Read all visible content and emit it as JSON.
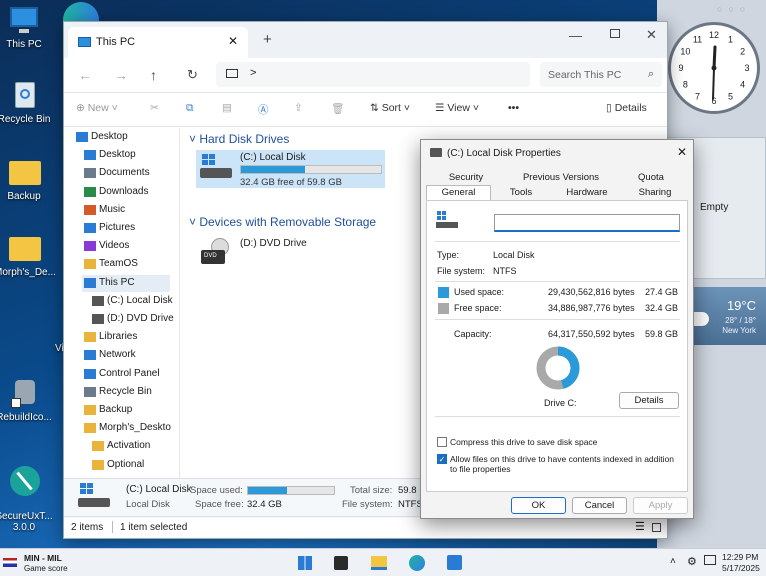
{
  "desktop": {
    "icons": [
      {
        "label": "This PC"
      },
      {
        "label": "Recycle Bin"
      },
      {
        "label": "Backup"
      },
      {
        "label": "Morph's_De..."
      },
      {
        "label": "RebuildIco..."
      },
      {
        "label": "SecureUxT...\n3.0.0"
      }
    ],
    "fragment_label": "Vi"
  },
  "widgets": {
    "clock_numbers": [
      "12",
      "1",
      "2",
      "3",
      "4",
      "5",
      "6",
      "7",
      "8",
      "9",
      "10",
      "11"
    ],
    "recycle_label": "Empty",
    "weather": {
      "temp": "19°C",
      "range": "28° / 18°",
      "city": "New York"
    }
  },
  "explorer": {
    "tab_title": "This PC",
    "new_tab_symbol": "+",
    "search_placeholder": "Search This PC",
    "address_chevron": ">",
    "commands": {
      "new": "New",
      "sort": "Sort",
      "view": "View",
      "more": "•••",
      "details": "Details"
    },
    "nav_items": [
      {
        "label": "Desktop",
        "color": "#2a7bd4"
      },
      {
        "label": "Desktop",
        "color": "#2a7bd4"
      },
      {
        "label": "Documents",
        "color": "#6b7a8c"
      },
      {
        "label": "Downloads",
        "color": "#2a8a4a"
      },
      {
        "label": "Music",
        "color": "#d45a2a"
      },
      {
        "label": "Pictures",
        "color": "#2a7bd4"
      },
      {
        "label": "Videos",
        "color": "#8a3ad4"
      },
      {
        "label": "TeamOS",
        "color": "#e8b43c"
      },
      {
        "label": "This PC",
        "color": "#2a7bd4"
      },
      {
        "label": "(C:) Local Disk",
        "color": "#555"
      },
      {
        "label": "(D:) DVD Drive",
        "color": "#555"
      },
      {
        "label": "Libraries",
        "color": "#e8b43c"
      },
      {
        "label": "Network",
        "color": "#2a7bd4"
      },
      {
        "label": "Control Panel",
        "color": "#2a7bd4"
      },
      {
        "label": "Recycle Bin",
        "color": "#6b7a8c"
      },
      {
        "label": "Backup",
        "color": "#e8b43c"
      },
      {
        "label": "Morph's_Deskto",
        "color": "#e8b43c"
      },
      {
        "label": "Activation",
        "color": "#e8b43c"
      },
      {
        "label": "Optional",
        "color": "#e8b43c"
      }
    ],
    "groups": {
      "hdd": "Hard Disk Drives",
      "removable": "Devices with Removable Storage"
    },
    "drive_c": {
      "name": "(C:) Local Disk",
      "free": "32.4 GB free of 59.8 GB",
      "used_fraction": 0.458
    },
    "drive_d": {
      "name": "(D:) DVD Drive",
      "badge": "DVD"
    },
    "details": {
      "name": "(C:) Local Disk",
      "type": "Local Disk",
      "space_used_label": "Space used:",
      "space_free_label": "Space free:",
      "space_free": "32.4 GB",
      "total_size_label": "Total size:",
      "total_size": "59.8",
      "filesystem_label": "File system:",
      "filesystem": "NTFS"
    },
    "status": {
      "items": "2 items",
      "selected": "1 item selected"
    }
  },
  "properties": {
    "title": "(C:) Local Disk Properties",
    "tabs_row1": [
      "Security",
      "Previous Versions",
      "Quota"
    ],
    "tabs_row2": [
      "General",
      "Tools",
      "Hardware",
      "Sharing"
    ],
    "name_value": "",
    "type_label": "Type:",
    "type_value": "Local Disk",
    "fs_label": "File system:",
    "fs_value": "NTFS",
    "used_label": "Used space:",
    "used_bytes": "29,430,562,816 bytes",
    "used_gb": "27.4 GB",
    "free_label": "Free space:",
    "free_bytes": "34,886,987,776 bytes",
    "free_gb": "32.4 GB",
    "cap_label": "Capacity:",
    "cap_bytes": "64,317,550,592 bytes",
    "cap_gb": "59.8 GB",
    "used_color": "#2b9ad8",
    "free_color": "#a9a9a9",
    "used_fraction": 0.458,
    "drive_label": "Drive C:",
    "details_button": "Details",
    "compress_label": "Compress this drive to save disk space",
    "compress_checked": false,
    "index_label": "Allow files on this drive to have contents indexed in addition to file properties",
    "index_checked": true,
    "ok": "OK",
    "cancel": "Cancel",
    "apply": "Apply"
  },
  "taskbar": {
    "game_title": "MIN - MIL",
    "game_sub": "Game score",
    "time": "12:29 PM",
    "date": "5/17/2025"
  }
}
